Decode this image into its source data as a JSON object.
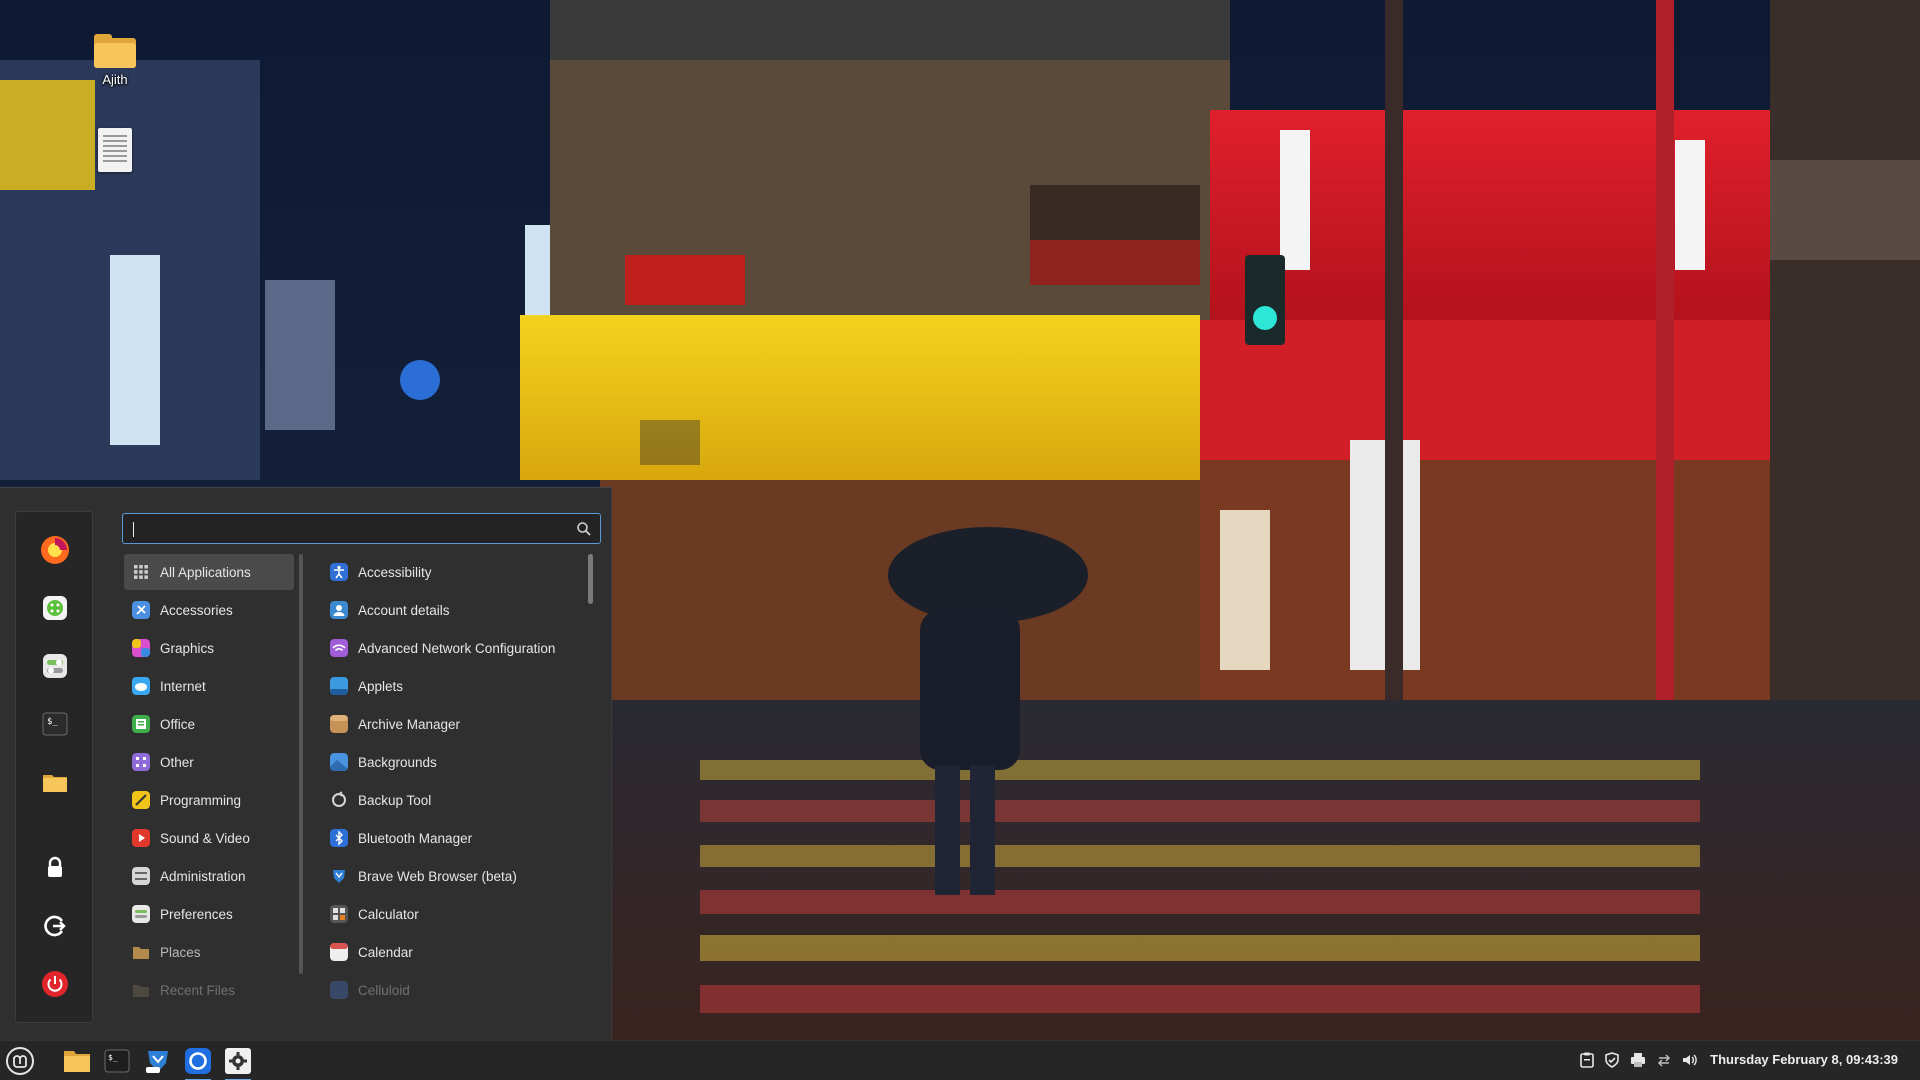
{
  "desktop": {
    "icons": [
      {
        "label": "Ajith",
        "icon": "folder-icon"
      },
      {
        "label": "",
        "icon": "text-document-icon"
      }
    ]
  },
  "menu": {
    "search": {
      "value": "",
      "placeholder": ""
    },
    "favorites": [
      {
        "name": "firefox",
        "icon": "firefox-icon",
        "color": "#ff6a1f"
      },
      {
        "name": "software-manager",
        "icon": "software-manager-icon",
        "color": "#5bbf3a"
      },
      {
        "name": "system-settings",
        "icon": "settings-toggle-icon",
        "color": "#a8d89a"
      },
      {
        "name": "terminal",
        "icon": "terminal-icon",
        "color": "#2b2b2b"
      },
      {
        "name": "files",
        "icon": "folder-icon",
        "color": "#f2b54a"
      },
      {
        "name": "lock-screen",
        "icon": "lock-icon",
        "color": "#ffffff"
      },
      {
        "name": "logout",
        "icon": "logout-icon",
        "color": "#ffffff"
      },
      {
        "name": "shutdown",
        "icon": "power-icon",
        "color": "#e0262b"
      }
    ],
    "categories": [
      {
        "label": "All Applications",
        "icon": "grid-icon",
        "color": "#cfcfcf",
        "active": true
      },
      {
        "label": "Accessories",
        "icon": "accessories-icon",
        "color": "#4a8fe0"
      },
      {
        "label": "Graphics",
        "icon": "graphics-icon",
        "color": "#d94fd0"
      },
      {
        "label": "Internet",
        "icon": "internet-icon",
        "color": "#3ba7f0"
      },
      {
        "label": "Office",
        "icon": "office-icon",
        "color": "#3fae4a"
      },
      {
        "label": "Other",
        "icon": "other-icon",
        "color": "#8e6bd6"
      },
      {
        "label": "Programming",
        "icon": "programming-icon",
        "color": "#f0c419"
      },
      {
        "label": "Sound & Video",
        "icon": "sound-video-icon",
        "color": "#e0392b"
      },
      {
        "label": "Administration",
        "icon": "administration-icon",
        "color": "#9c9c9c"
      },
      {
        "label": "Preferences",
        "icon": "preferences-icon",
        "color": "#7bbf5a"
      },
      {
        "label": "Places",
        "icon": "places-folder-icon",
        "color": "#b28a4a",
        "dim": true
      },
      {
        "label": "Recent Files",
        "icon": "recent-files-icon",
        "color": "#8a7a5a",
        "faded": true
      }
    ],
    "apps": [
      {
        "label": "Accessibility",
        "icon": "accessibility-icon",
        "color": "#2f6fd6"
      },
      {
        "label": "Account details",
        "icon": "account-details-icon",
        "color": "#3b8ad0"
      },
      {
        "label": "Advanced Network Configuration",
        "icon": "network-config-icon",
        "color": "#a15dd8"
      },
      {
        "label": "Applets",
        "icon": "applets-icon",
        "color": "#3c9be0"
      },
      {
        "label": "Archive Manager",
        "icon": "archive-manager-icon",
        "color": "#c79255"
      },
      {
        "label": "Backgrounds",
        "icon": "backgrounds-icon",
        "color": "#4a93e0"
      },
      {
        "label": "Backup Tool",
        "icon": "backup-tool-icon",
        "color": "#d6d6d6"
      },
      {
        "label": "Bluetooth Manager",
        "icon": "bluetooth-icon",
        "color": "#2d6fd8"
      },
      {
        "label": "Brave Web Browser (beta)",
        "icon": "brave-beta-icon",
        "color": "#2f7fd6"
      },
      {
        "label": "Calculator",
        "icon": "calculator-icon",
        "color": "#555555"
      },
      {
        "label": "Calendar",
        "icon": "calendar-icon",
        "color": "#d9534f"
      },
      {
        "label": "Celluloid",
        "icon": "celluloid-icon",
        "color": "#4a7ad0",
        "faded": true
      }
    ]
  },
  "panel": {
    "launchers": [
      {
        "name": "menu",
        "icon": "linux-mint-menu-icon"
      },
      {
        "name": "files",
        "icon": "folder-icon"
      },
      {
        "name": "terminal",
        "icon": "terminal-icon"
      },
      {
        "name": "brave-beta",
        "icon": "brave-beta-icon"
      },
      {
        "name": "brave",
        "icon": "browser-ring-icon"
      },
      {
        "name": "settings",
        "icon": "settings-gear-icon"
      }
    ],
    "tray": [
      "clipboard-icon",
      "shield-update-icon",
      "printer-icon",
      "network-icon",
      "volume-icon"
    ],
    "clock": "Thursday February  8, 09:43:39"
  }
}
